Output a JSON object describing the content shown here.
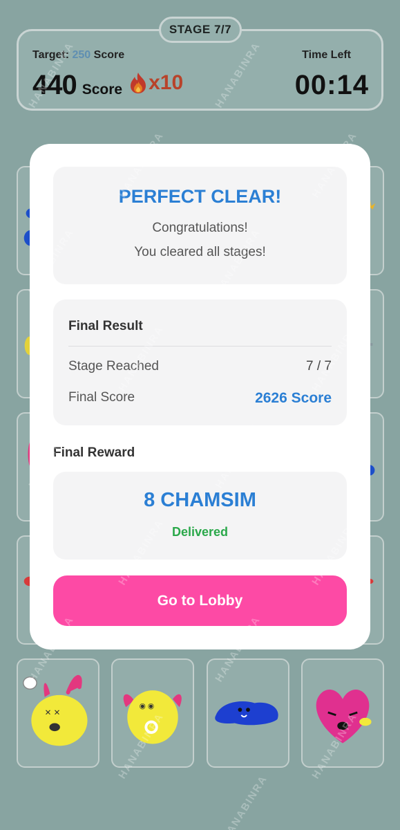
{
  "hud": {
    "stage": "STAGE 7/7",
    "target_prefix": "Target:",
    "target_value": "250",
    "target_suffix": "Score",
    "score": "440",
    "score_unit": "Score",
    "combo": "x10",
    "time_label": "Time Left",
    "time_value": "00:14"
  },
  "modal": {
    "title": "PERFECT CLEAR!",
    "subtitle_line1": "Congratulations!",
    "subtitle_line2": "You cleared all stages!",
    "result": {
      "heading": "Final Result",
      "stage_label": "Stage Reached",
      "stage_value": "7 / 7",
      "score_label": "Final Score",
      "score_value": "2626 Score"
    },
    "reward": {
      "heading": "Final Reward",
      "amount": "8 CHAMSIM",
      "status": "Delivered"
    },
    "button_label": "Go to Lobby"
  },
  "watermark": "HANABINRA",
  "colors": {
    "accent_blue": "#2b7fd4",
    "button_pink": "#fd4aa5",
    "delivered_green": "#2aa84a",
    "combo_red": "#b8432a",
    "backdrop": "#88a4a1"
  },
  "icons": {
    "combo": "fire-icon"
  }
}
